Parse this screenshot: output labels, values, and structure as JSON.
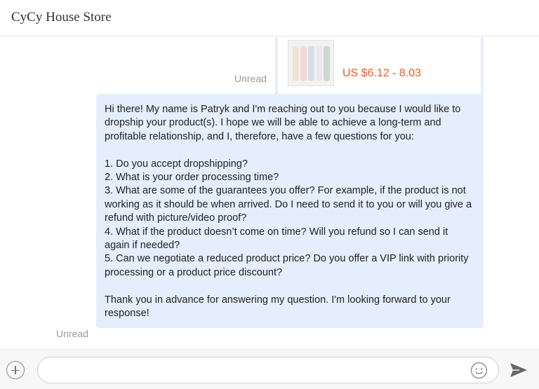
{
  "header": {
    "title": "CyCy House Store"
  },
  "product": {
    "name": "",
    "price": "US $6.12 - 8.03",
    "unread": "Unread",
    "image_icon": "product-thumbnail"
  },
  "message": {
    "unread": "Unread",
    "text": "Hi there! My name is Patryk and I'm reaching out to you because I would like to dropship your product(s). I hope we will be able to achieve a long-term and profitable relationship, and I, therefore, have a few questions for you:\n\n1. Do you accept dropshipping?\n2. What is your order processing time?\n3. What are some of the guarantees you offer? For example, if the product is not working as it should be when arrived. Do I need to send it to you or will you give a refund with picture/video proof?\n4. What if the product doesn’t come on time? Will you refund so I can send it again if needed?\n5. Can we negotiate a reduced product price? Do you offer a VIP link with priority processing or a product price discount?\n\nThank you in advance for answering my question. I'm looking forward to your response!"
  },
  "input": {
    "value": "",
    "placeholder": "",
    "add_icon": "plus-circle-icon",
    "emoji_icon": "smiley-icon",
    "send_icon": "send-arrow-icon"
  },
  "colors": {
    "bubble": "#e4eefc",
    "price": "#f05a21",
    "unread": "#9a9a9a"
  }
}
